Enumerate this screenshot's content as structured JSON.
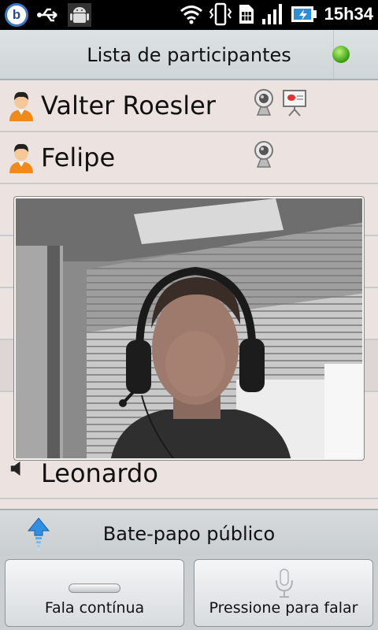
{
  "status_bar": {
    "time": "15h34",
    "icons": [
      "bigbluebutton-logo-icon",
      "usb-icon",
      "android-debug-icon",
      "wifi-icon",
      "vibrate-icon",
      "sim-icon",
      "signal-icon",
      "battery-charging-icon"
    ]
  },
  "header": {
    "title": "Lista de participantes",
    "status_color": "#3fa014"
  },
  "participants": [
    {
      "name": "Valter Roesler",
      "icons": [
        "webcam-icon",
        "presenter-icon"
      ]
    },
    {
      "name": "Felipe",
      "icons": [
        "webcam-icon"
      ]
    },
    {
      "name": "Leonardo",
      "icons": [
        "speaker-icon"
      ]
    }
  ],
  "chat": {
    "title": "Bate-papo público",
    "icon": "arrow-up-icon"
  },
  "buttons": {
    "continuous": "Fala contínua",
    "push_to_talk": "Pressione para falar"
  }
}
